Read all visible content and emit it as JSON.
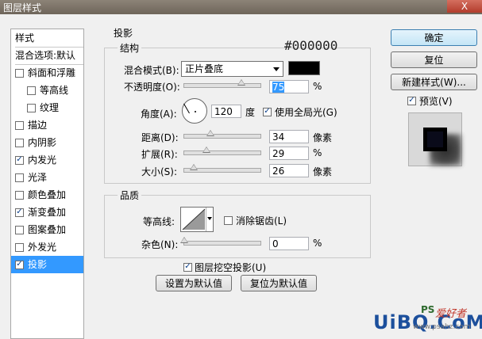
{
  "window": {
    "title": "图层样式",
    "close_glyph": "X"
  },
  "sidebar": {
    "styles_header": "样式",
    "blend_options": "混合选项:默认",
    "items": [
      {
        "label": "斜面和浮雕",
        "checked": false,
        "indent": false
      },
      {
        "label": "等高线",
        "checked": false,
        "indent": true
      },
      {
        "label": "纹理",
        "checked": false,
        "indent": true
      },
      {
        "label": "描边",
        "checked": false,
        "indent": false
      },
      {
        "label": "内阴影",
        "checked": false,
        "indent": false
      },
      {
        "label": "内发光",
        "checked": true,
        "indent": false
      },
      {
        "label": "光泽",
        "checked": false,
        "indent": false
      },
      {
        "label": "颜色叠加",
        "checked": false,
        "indent": false
      },
      {
        "label": "渐变叠加",
        "checked": true,
        "indent": false
      },
      {
        "label": "图案叠加",
        "checked": false,
        "indent": false
      },
      {
        "label": "外发光",
        "checked": false,
        "indent": false
      },
      {
        "label": "投影",
        "checked": true,
        "indent": false,
        "selected": true
      }
    ]
  },
  "shadow": {
    "section_title": "投影",
    "structure_title": "结构",
    "color_hex_label": "#000000",
    "blend_mode_label": "混合模式(B):",
    "blend_mode_value": "正片叠底",
    "color_swatch": "#000000",
    "opacity_label": "不透明度(O):",
    "opacity_value": "75",
    "opacity_unit": "%",
    "opacity_level": 0.75,
    "angle_label": "角度(A):",
    "angle_value": "120",
    "angle_unit": "度",
    "global_light_label": "使用全局光(G)",
    "global_light_checked": true,
    "distance_label": "距离(D):",
    "distance_value": "34",
    "distance_unit": "像素",
    "distance_level": 0.34,
    "spread_label": "扩展(R):",
    "spread_value": "29",
    "spread_unit": "%",
    "spread_level": 0.29,
    "size_label": "大小(S):",
    "size_value": "26",
    "size_unit": "像素",
    "size_level": 0.13,
    "quality_title": "品质",
    "contour_label": "等高线:",
    "antialias_label": "消除锯齿(L)",
    "noise_label": "杂色(N):",
    "noise_value": "0",
    "noise_unit": "%",
    "noise_level": 0,
    "knockout_label": "图层挖空投影(U)",
    "knockout_checked": true,
    "set_default_label": "设置为默认值",
    "reset_default_label": "复位为默认值"
  },
  "actions": {
    "ok_label": "确定",
    "reset_label": "复位",
    "new_style_label": "新建样式(W)...",
    "preview_label": "预览(V)",
    "preview_checked": true
  },
  "watermark": {
    "brand": "UiBQ.CoM",
    "ps_text": "PS",
    "site_cn": "爱好者",
    "url": "www.psahz.com"
  }
}
